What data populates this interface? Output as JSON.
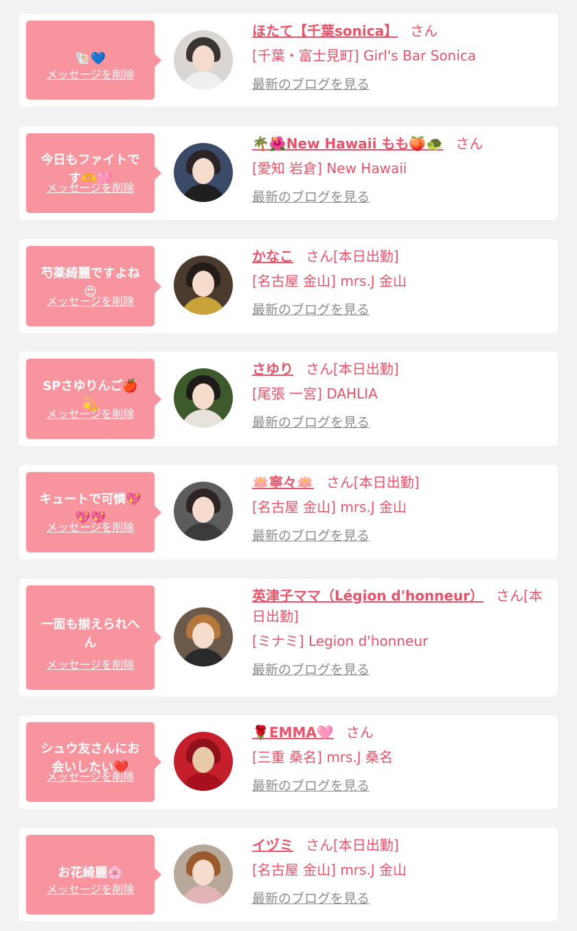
{
  "delete_label": "メッセージを削除",
  "blog_label": "最新のブログを見る",
  "colors": {
    "pink": "#f7949d",
    "name": "#e8536a",
    "link": "#8c8c8c",
    "bg": "#f2f2f2"
  },
  "items": [
    {
      "message": "🐚💙",
      "name": "ほたて【千葉sonica】",
      "suffix": "さん",
      "shop": "[千葉・富士見町] Girl's Bar Sonica"
    },
    {
      "message": "今日もファイトで\nす🫶🩷",
      "name": "🌴🌺New Hawaii もも🍑🐢",
      "suffix": "さん",
      "shop": "[愛知 岩倉] New Hawaii"
    },
    {
      "message": "芍薬綺麗ですよね\n😍",
      "name": "かなこ",
      "suffix": "さん[本日出勤]",
      "shop": "[名古屋 金山] mrs.J 金山"
    },
    {
      "message": "SPさゆりんご🍎\n💫",
      "name": "さゆり",
      "suffix": "さん[本日出勤]",
      "shop": "[尾張 一宮] DAHLIA"
    },
    {
      "message": "キュートで可憐💖\n💖💖",
      "name": "🪷寧々🪷",
      "suffix": "さん[本日出勤]",
      "shop": "[名古屋 金山] mrs.J 金山"
    },
    {
      "message": "一面も揃えられへ\nん",
      "name": "英津子ママ（Légion d'honneur）",
      "suffix": "さん[本日出勤]",
      "shop": "[ミナミ] Legion d'honneur"
    },
    {
      "message": "シュウ友さんにお\n会いしたい❤️",
      "name": "🌹EMMA🩷",
      "suffix": "さん",
      "shop": "[三重 桑名] mrs.J 桑名"
    },
    {
      "message": "お花綺麗🌸",
      "name": "イヅミ",
      "suffix": "さん[本日出勤]",
      "shop": "[名古屋 金山] mrs.J 金山"
    }
  ]
}
